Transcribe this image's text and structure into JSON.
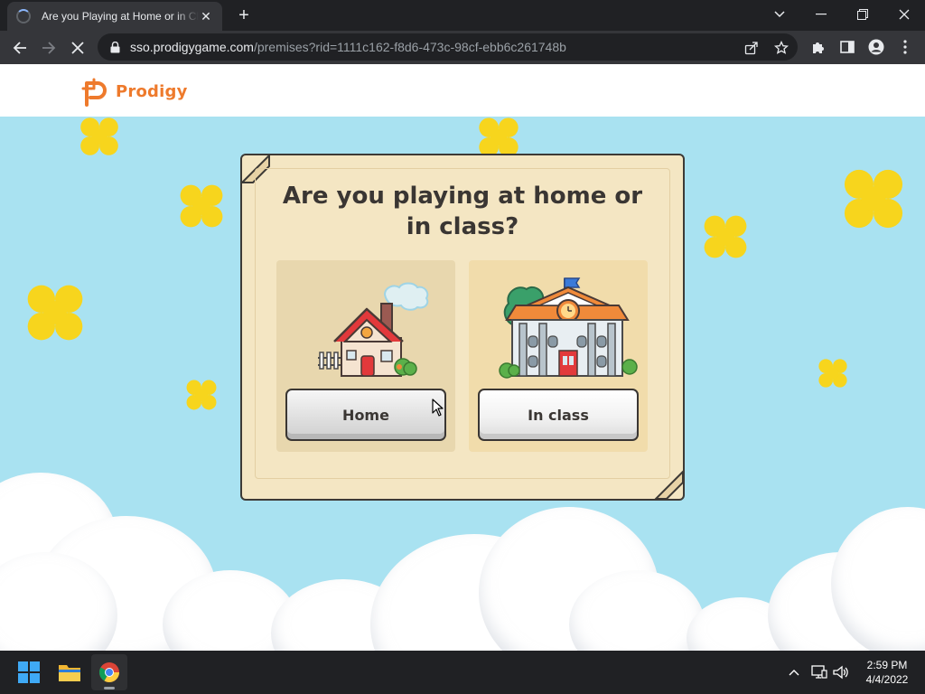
{
  "browser": {
    "tab_title": "Are you Playing at Home or in Class?",
    "url_host": "sso.prodigygame.com",
    "url_path": "/premises?rid=1111c162-f8d6-473c-98cf-ebb6c261748b"
  },
  "page": {
    "logo_text": "Prodigy",
    "question": "Are you playing at home or in class?",
    "options": [
      {
        "label": "Home"
      },
      {
        "label": "In class"
      }
    ]
  },
  "taskbar": {
    "time": "2:59 PM",
    "date": "4/4/2022"
  },
  "colors": {
    "sky": "#a9e2f1",
    "brand_orange": "#ee7a2c",
    "card": "#f4e6c3",
    "sparkle": "#f7d51d"
  }
}
